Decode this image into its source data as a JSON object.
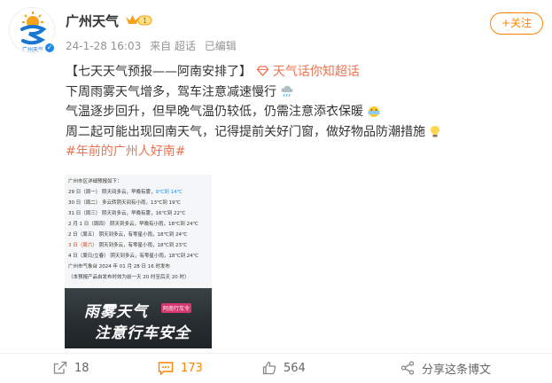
{
  "header": {
    "username": "广州天气",
    "vip_level": "1",
    "avatar_text": "广州天气",
    "timestamp": "24-1-28 16:03",
    "source": "来自 超话",
    "edited": "已编辑",
    "follow_label": "+关注"
  },
  "post": {
    "line1_title": "【七天天气预报——阿南安排了】",
    "line1_link": "天气话你知超话",
    "line2": "下周雨雾天气增多，驾车注意减速慢行",
    "line3": "气温逐步回升，但早晚气温仍较低，仍需注意添衣保暖",
    "line4": "周二起可能出现回南天气，记得提前关好门窗，做好物品防潮措施",
    "hashtag": "#年前的广州人好南#"
  },
  "bulletin": {
    "heading": "广州市区详细预报如下：",
    "rows": [
      {
        "date": "29 日（周一）",
        "weather": "阴天间多云，早晚有雾，",
        "temp": "9℃到 14℃"
      },
      {
        "date": "30 日（周二）",
        "weather": "多云转阴天间有小雨，",
        "temp": "13℃到 19℃"
      },
      {
        "date": "31 日（周三）",
        "weather": "阴天到多云，早晚有雾，",
        "temp": "16℃到 22℃"
      },
      {
        "date": "2 月 1 日（周四）",
        "weather": "阴天到多云，早晚有小雨，",
        "temp": "18℃到 24℃"
      },
      {
        "date": "2 日（周五）",
        "weather": "阴天到多云，有零星小雨，",
        "temp": "18℃到 24℃"
      },
      {
        "date": "3 日（周六）",
        "weather": "阴天到多云，有零星小雨，",
        "temp": "18℃到 23℃"
      },
      {
        "date": "4 日（周日/立春）",
        "weather": "阴天到多云，有零星小雨，",
        "temp": "18℃到 24℃"
      }
    ],
    "issuer": "广州市气象台  2024 年 01 月 28 日 16 时发布",
    "note": "（本预报产品自发布时效为前一天 20 时至后天 20 时）",
    "banner_line1": "雨雾天气",
    "banner_line2": "注意行车安全",
    "banner_tag": "阿南行车令"
  },
  "actions": {
    "reposts": "18",
    "comments": "173",
    "likes": "564",
    "share_label": "分享这条博文"
  },
  "colors": {
    "accent_orange": "#ff8200",
    "link_orange": "#eb7350",
    "verify_blue": "#1e88e5"
  }
}
